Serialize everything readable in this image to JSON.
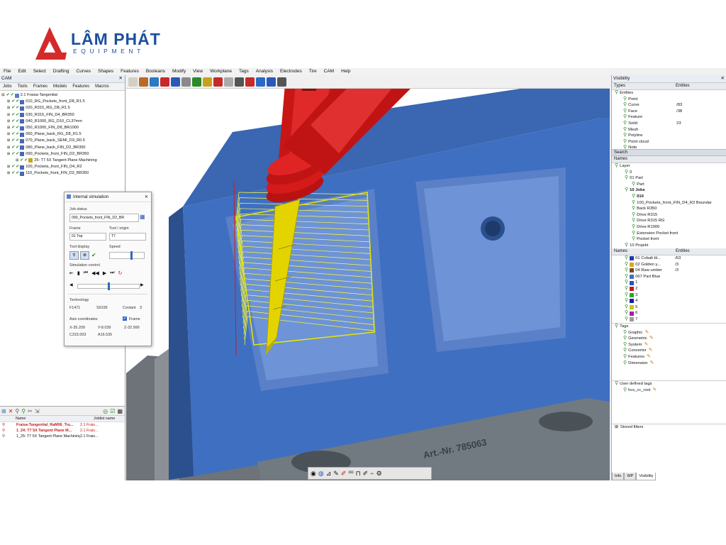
{
  "brand": {
    "title": "LÂM PHÁT",
    "subtitle": "EQUIPMENT",
    "colors": {
      "red": "#d42a2a",
      "blue": "#1d4f9e"
    }
  },
  "menu": [
    "File",
    "Edit",
    "Select",
    "Drafting",
    "Curves",
    "Shapes",
    "Features",
    "Booleans",
    "Modify",
    "View",
    "Workplane",
    "Tags",
    "Analysis",
    "Electrodes",
    "Tire",
    "CAM",
    "Help"
  ],
  "cam_panel": {
    "title": "CAM",
    "tabs": [
      "Jobs",
      "Tools",
      "Frames",
      "Models",
      "Features",
      "Macros"
    ],
    "root": "2.1 Fraisa-Tangential",
    "jobs": [
      "010_RG_Pockets_front_D8_R1.5",
      "020_R315_RG_D8_R1.5",
      "030_R315_FIN_D4_BR350",
      "040_R1000_RG_D10_CL37mm",
      "050_R1000_FIN_D8_BR1000",
      "060_Plane_back_RG_D8_R1.5",
      "070_Plane_back_SEMI_D3_R0.5",
      "080_Plane_back_FIN_D2_BR350",
      "090_Pockets_front_FIN_D2_BR350",
      "25: T7 5X Tangent Plane Machining",
      "100_Pockets_front_FIN_D4_R2",
      "110_Pockets_front_FIN_D2_BR350"
    ]
  },
  "job_list": {
    "col_name": "Name",
    "col_joblist": "Joblist name",
    "rows": [
      {
        "name": "Fraisa-Tangential_RaM06_Tru...",
        "joblist": "2.1 Frais..."
      },
      {
        "name": "1_24: T7 5X Tangent Plane M...",
        "joblist": "2.1 Frais..."
      },
      {
        "name": "1_25: T7 5X Tangent Plane Machining",
        "joblist": "2.1 Frais..."
      }
    ]
  },
  "simulation": {
    "title": "Internal simulation",
    "job_status_label": "Job status",
    "job_value": "090_Pockets_front_FIN_D2_BR",
    "frame_label": "Frame",
    "frame_value": "01 Top",
    "tool_label": "Tool / origin",
    "tool_value": "T7",
    "tool_display_label": "Tool display",
    "speed_label": "Speed",
    "speed_level": 0.65,
    "sim_control_label": "Simulation control",
    "progress_level": 0.5,
    "technology_label": "Technology",
    "feed": "F1471",
    "spindle": "S9195",
    "coolant": "Coolant",
    "coolant_value": "3",
    "axis_label": "Axis coordinates",
    "frame_check": "Frame",
    "x": "X-35.209",
    "y": "Y-8.039",
    "z": "Z-32.999",
    "c": "C315.003",
    "a": "A16.535"
  },
  "part": {
    "label": "Art.-Nr. 785063",
    "colors": {
      "body": "#3f6fc1",
      "dark": "#2c4f8e",
      "face": "#6e93d6",
      "tool": "#e3d400",
      "spindle": "#d51a1a",
      "path": "#ffff33"
    }
  },
  "visibility": {
    "title": "Visibility",
    "col_types": "Types",
    "col_entities": "Entities",
    "types": [
      {
        "name": "Entities",
        "count": ""
      },
      {
        "name": "Point",
        "count": ""
      },
      {
        "name": "Curve",
        "count": "/83"
      },
      {
        "name": "Face",
        "count": "/38"
      },
      {
        "name": "Feature",
        "count": ""
      },
      {
        "name": "Solid",
        "count": "23"
      },
      {
        "name": "Mesh",
        "count": ""
      },
      {
        "name": "Polyline",
        "count": ""
      },
      {
        "name": "Point cloud",
        "count": ""
      },
      {
        "name": "Note",
        "count": ""
      }
    ],
    "search_label": "Search",
    "names_label": "Names",
    "layers": [
      "Layer",
      "0",
      "01 Part",
      "Part",
      "10 Jobs",
      "010",
      "100_Pockets_front_FIN_D4_R2 Boundar",
      "Back R350",
      "Drive R315",
      "Drive R315 RG",
      "Drive R1000",
      "Extension Pocket front",
      "Pocket front",
      "10 Projekt"
    ],
    "colors_header": {
      "names": "Names",
      "entities": "Entities"
    },
    "colors": [
      {
        "name": "01 Cobalt bl...",
        "count": "/63",
        "hex": "#1c3aa9"
      },
      {
        "name": "02 Golden y...",
        "count": "/3",
        "hex": "#d9a520"
      },
      {
        "name": "04 Raw umber",
        "count": "/3",
        "hex": "#7a4a1a"
      },
      {
        "name": "067 Part Blue",
        "count": "",
        "hex": "#3f6fc1"
      },
      {
        "name": "1",
        "count": "",
        "hex": "#2a4fd0"
      },
      {
        "name": "2",
        "count": "",
        "hex": "#c61a1a"
      },
      {
        "name": "3",
        "count": "",
        "hex": "#2aa52a"
      },
      {
        "name": "4",
        "count": "",
        "hex": "#1a1aa9"
      },
      {
        "name": "5",
        "count": "",
        "hex": "#c6c61a"
      },
      {
        "name": "6",
        "count": "",
        "hex": "#a91aa9"
      },
      {
        "name": "7",
        "count": "",
        "hex": "#9a9a9a"
      }
    ],
    "tags": [
      "Tags",
      "Graphic",
      "Geometric",
      "System",
      "Converter",
      "Features",
      "Dimension"
    ],
    "user_tags": [
      "User defined tags",
      "hcs_cc_root"
    ],
    "stored_filters": "Stored filters",
    "bottom_tabs": [
      "Info",
      "WP",
      "Visibility"
    ]
  }
}
